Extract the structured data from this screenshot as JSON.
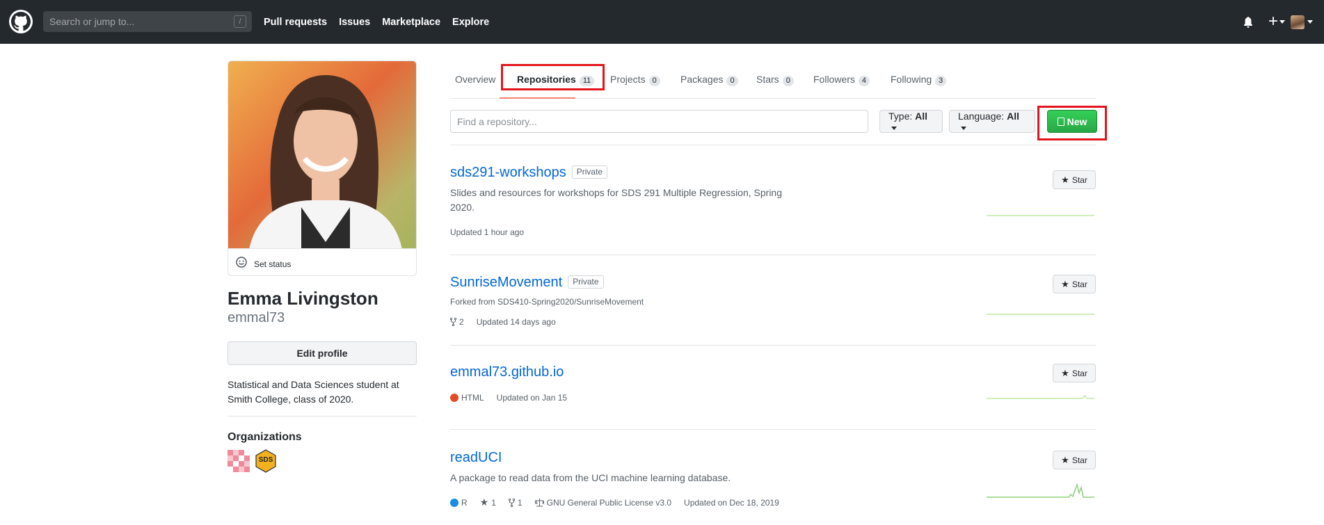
{
  "header": {
    "search_placeholder": "Search or jump to...",
    "search_shortcut": "/",
    "nav": [
      "Pull requests",
      "Issues",
      "Marketplace",
      "Explore"
    ],
    "plus_label": "+"
  },
  "profile": {
    "set_status": "Set status",
    "name": "Emma Livingston",
    "username": "emmal73",
    "edit_profile": "Edit profile",
    "bio_line1": "Statistical and Data Sciences student at",
    "bio_line2": "Smith College, class of 2020.",
    "organizations_heading": "Organizations",
    "org2_label": "SDS"
  },
  "tabs": [
    {
      "label": "Overview",
      "count": ""
    },
    {
      "label": "Repositories",
      "count": "11"
    },
    {
      "label": "Projects",
      "count": "0"
    },
    {
      "label": "Packages",
      "count": "0"
    },
    {
      "label": "Stars",
      "count": "0"
    },
    {
      "label": "Followers",
      "count": "4"
    },
    {
      "label": "Following",
      "count": "3"
    }
  ],
  "filter": {
    "find_placeholder": "Find a repository...",
    "type_label": "Type:",
    "type_value": "All",
    "language_label": "Language:",
    "language_value": "All",
    "new_label": "New"
  },
  "repos": [
    {
      "name": "sds291-workshops",
      "badge": "Private",
      "desc_line1": "Slides and resources for workshops for SDS 291 Multiple Regression, Spring",
      "desc_line2": "2020.",
      "updated": "Updated 1 hour ago",
      "star_label": "Star"
    },
    {
      "name": "SunriseMovement",
      "badge": "Private",
      "forked_from": "Forked from SDS410-Spring2020/SunriseMovement",
      "forks": "2",
      "updated": "Updated 14 days ago",
      "star_label": "Star"
    },
    {
      "name": "emmal73.github.io",
      "language": "HTML",
      "language_color": "#e34c26",
      "updated": "Updated on Jan 15",
      "star_label": "Star"
    },
    {
      "name": "readUCI",
      "desc_line1": "A package to read data from the UCI machine learning database.",
      "language": "R",
      "language_color": "#198ce7",
      "stars": "1",
      "forks": "1",
      "license": "GNU General Public License v3.0",
      "updated": "Updated on Dec 18, 2019",
      "star_label": "Star"
    }
  ],
  "colors": {
    "header_bg": "#24292e",
    "link": "#0366d6",
    "new_button": "#2ea44f",
    "highlight_box": "#e3141b",
    "active_tab_underline": "#f9826c",
    "sparkline": "#c2e8a6"
  }
}
